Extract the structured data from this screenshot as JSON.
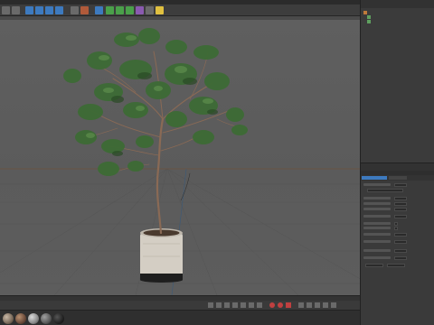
{
  "app": {
    "menu_items": [],
    "toolbar_icons": [
      "undo-icon",
      "redo-icon",
      "select-icon",
      "move-icon",
      "scale-icon",
      "rotate-icon",
      "render-icon",
      "render-view-icon",
      "cube-icon",
      "spline-icon",
      "nurbs-icon",
      "array-icon",
      "deformer-icon",
      "camera-icon",
      "light-icon"
    ]
  },
  "viewport": {
    "menu_items": [],
    "grid_spacing_label": "",
    "object": "potted tree"
  },
  "object_manager": {
    "tabs": [],
    "items": [
      {
        "name": "",
        "color": "#c07a3a"
      },
      {
        "name": "",
        "color": "#5fa05f"
      },
      {
        "name": "",
        "color": "#5fa05f"
      }
    ]
  },
  "attributes": {
    "title": "",
    "tabs": [
      "",
      ""
    ],
    "fields": [
      {
        "label": "",
        "value": ""
      },
      {
        "label": "",
        "value": ""
      },
      {
        "label": "",
        "value": ""
      },
      {
        "label": "",
        "value": ""
      },
      {
        "label": "",
        "value": ""
      },
      {
        "label": "",
        "value": ""
      },
      {
        "label": "",
        "value": ""
      },
      {
        "label": "",
        "value": ""
      },
      {
        "label": "",
        "value": ""
      },
      {
        "label": "",
        "value": ""
      },
      {
        "label": "",
        "value": ""
      },
      {
        "label": "",
        "value": ""
      }
    ]
  },
  "timeline": {
    "start": "",
    "end": "",
    "current": ""
  },
  "materials": [
    {
      "name": "",
      "color": "#7a6a5a"
    },
    {
      "name": "",
      "color": "#6a4a3a"
    },
    {
      "name": "",
      "color": "#8a8a8a"
    },
    {
      "name": "",
      "color": "#5a5a5a"
    },
    {
      "name": "",
      "color": "#222222"
    }
  ],
  "colors": {
    "accent": "#e0a040",
    "foliage": "#3d6b35",
    "branch": "#8a6a55",
    "pot": "#d8d2c8"
  }
}
